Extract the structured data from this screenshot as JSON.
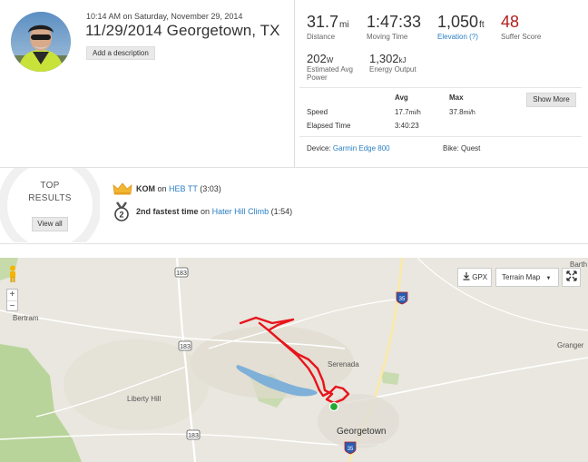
{
  "activity": {
    "datetime": "10:14 AM on Saturday, November 29, 2014",
    "title": "11/29/2014 Georgetown, TX",
    "add_description": "Add a description"
  },
  "stats": {
    "distance": {
      "value": "31.7",
      "unit": "mi",
      "label": "Distance"
    },
    "moving_time": {
      "value": "1:47:33",
      "label": "Moving Time"
    },
    "elevation": {
      "value": "1,050",
      "unit": "ft",
      "label": "Elevation (?)"
    },
    "suffer_score": {
      "value": "48",
      "label": "Suffer Score"
    },
    "power": {
      "value": "202",
      "unit": "W",
      "label": "Estimated Avg Power"
    },
    "energy": {
      "value": "1,302",
      "unit": "kJ",
      "label": "Energy Output"
    }
  },
  "table": {
    "headers": {
      "avg": "Avg",
      "max": "Max"
    },
    "speed": {
      "label": "Speed",
      "avg": "17.7",
      "avg_unit": "mi/h",
      "max": "37.8",
      "max_unit": "mi/h"
    },
    "elapsed": {
      "label": "Elapsed Time",
      "avg": "3:40:23"
    },
    "show_more": "Show More"
  },
  "device": {
    "label": "Device:",
    "value": "Garmin Edge 800"
  },
  "bike": {
    "label": "Bike:",
    "value": "Quest"
  },
  "top_results": {
    "title_line1": "TOP",
    "title_line2": "RESULTS",
    "view_all": "View all",
    "items": [
      {
        "rank": "KOM",
        "on": "on",
        "segment": "HEB TT",
        "time": "(3:03)",
        "icon": "crown-icon"
      },
      {
        "rank": "2nd fastest time",
        "on": "on",
        "segment": "Hater Hill Climb",
        "time": "(1:54)",
        "icon": "medal-2-icon",
        "medal_number": "2"
      }
    ]
  },
  "map": {
    "gpx": "GPX",
    "terrain": "Terrain Map",
    "zoom_in": "+",
    "zoom_out": "−",
    "labels": {
      "bertram": "Bertram",
      "liberty_hill": "Liberty Hill",
      "serenada": "Serenada",
      "georgetown": "Georgetown",
      "granger": "Granger",
      "barth": "Barth"
    },
    "shields": {
      "h183a": "183",
      "h183b": "183",
      "h183c": "183",
      "i35a": "35",
      "i35b": "35"
    },
    "colors": {
      "route": "#e8141b",
      "start": "#22aa33",
      "water": "#7fb0d8",
      "park": "#b9d49a"
    }
  }
}
